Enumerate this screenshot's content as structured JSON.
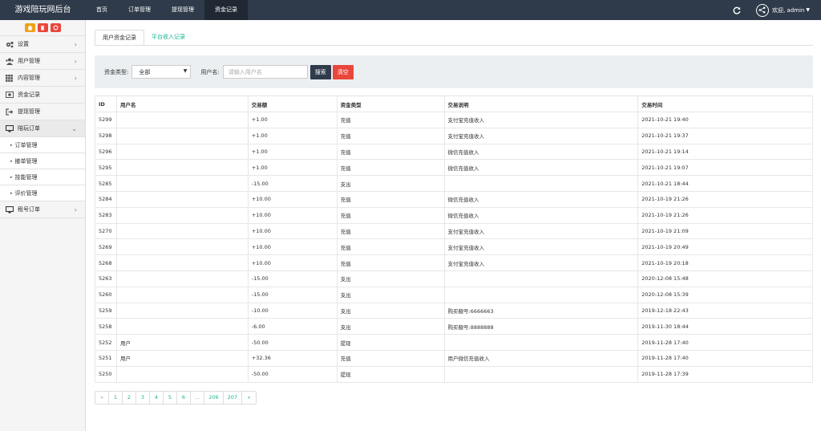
{
  "brand": "游戏陪玩网后台",
  "topnav": [
    "首页",
    "订单管理",
    "提现管理",
    "资金记录"
  ],
  "topnav_active": 3,
  "user": {
    "welcome": "欢迎, admin"
  },
  "sidebar": {
    "menu": [
      {
        "label": "设置",
        "icon": "gears-icon",
        "arrow": "›"
      },
      {
        "label": "用户管理",
        "icon": "users-icon",
        "arrow": "›"
      },
      {
        "label": "内容管理",
        "icon": "grid-icon",
        "arrow": "›"
      },
      {
        "label": "资金记录",
        "icon": "money-icon",
        "arrow": ""
      },
      {
        "label": "提现管理",
        "icon": "sign-out-icon",
        "arrow": ""
      },
      {
        "label": "陪玩订单",
        "icon": "desktop-icon",
        "arrow": "⌄"
      }
    ],
    "sub": [
      "订单管理",
      "撤单管理",
      "技能管理",
      "评价管理"
    ],
    "last": {
      "label": "租号订单",
      "icon": "desktop-icon",
      "arrow": "›"
    }
  },
  "tabs": [
    "用户资金记录",
    "平台收入记录"
  ],
  "filter": {
    "type_label": "资金类型:",
    "type_value": "全部",
    "user_label": "用户名:",
    "user_placeholder": "请输入用户名",
    "search": "搜索",
    "clear": "清空"
  },
  "table": {
    "headers": [
      "ID",
      "用户名",
      "交易额",
      "资金类型",
      "交易说明",
      "交易时间"
    ],
    "rows": [
      [
        "5299",
        "",
        "+1.00",
        "充值",
        "支付宝充值收入",
        "2021-10-21 19:40"
      ],
      [
        "5298",
        "",
        "+1.00",
        "充值",
        "支付宝充值收入",
        "2021-10-21 19:37"
      ],
      [
        "5296",
        "",
        "+1.00",
        "充值",
        "微信充值收入",
        "2021-10-21 19:14"
      ],
      [
        "5295",
        "",
        "+1.00",
        "充值",
        "微信充值收入",
        "2021-10-21 19:07"
      ],
      [
        "5285",
        "",
        "-15.00",
        "支出",
        "",
        "2021-10-21 18:44"
      ],
      [
        "5284",
        "",
        "+10.00",
        "充值",
        "微信充值收入",
        "2021-10-19 21:26"
      ],
      [
        "5283",
        "",
        "+10.00",
        "充值",
        "微信充值收入",
        "2021-10-19 21:26"
      ],
      [
        "5270",
        "",
        "+10.00",
        "充值",
        "支付宝充值收入",
        "2021-10-19 21:09"
      ],
      [
        "5269",
        "",
        "+10.00",
        "充值",
        "支付宝充值收入",
        "2021-10-19 20:49"
      ],
      [
        "5268",
        "",
        "+10.00",
        "充值",
        "支付宝充值收入",
        "2021-10-19 20:18"
      ],
      [
        "5263",
        "",
        "-15.00",
        "支出",
        "",
        "2020-12-08 15:48"
      ],
      [
        "5260",
        "",
        "-15.00",
        "支出",
        "",
        "2020-12-08 15:39"
      ],
      [
        "5259",
        "",
        "-10.00",
        "支出",
        "购买靓号:6666663",
        "2019-12-18 22:43"
      ],
      [
        "5258",
        "",
        "-6.00",
        "支出",
        "购买靓号:8888888",
        "2019-11-30 18:44"
      ],
      [
        "5252",
        "用户",
        "-50.00",
        "提现",
        "",
        "2019-11-28 17:40"
      ],
      [
        "5251",
        "用户",
        "+32.36",
        "充值",
        "用户微信充值收入",
        "2019-11-28 17:40"
      ],
      [
        "5250",
        "",
        "-50.00",
        "提现",
        "",
        "2019-11-28 17:39"
      ]
    ]
  },
  "pagination": [
    "«",
    "1",
    "2",
    "3",
    "4",
    "5",
    "6",
    "...",
    "206",
    "207",
    "»"
  ],
  "colors": {
    "nav": "#2f3b4a",
    "accent": "#1ab394",
    "danger": "#e9473c",
    "warning": "#f0a119"
  }
}
